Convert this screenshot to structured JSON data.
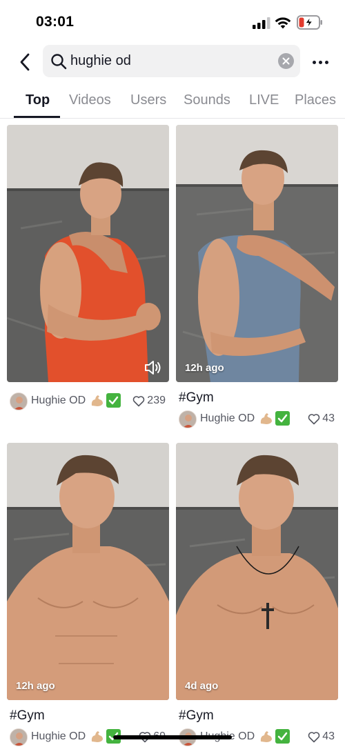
{
  "status_bar": {
    "time": "03:01"
  },
  "search": {
    "query": "hughie od"
  },
  "tabs": [
    {
      "label": "Top",
      "active": true
    },
    {
      "label": "Videos",
      "active": false
    },
    {
      "label": "Users",
      "active": false
    },
    {
      "label": "Sounds",
      "active": false
    },
    {
      "label": "LIVE",
      "active": false
    },
    {
      "label": "Places",
      "active": false
    }
  ],
  "results": [
    {
      "time_ago": "",
      "caption": "",
      "author": "Hughie OD",
      "likes": "239",
      "shirt_color": "#e2502c",
      "has_sound_icon": true
    },
    {
      "time_ago": "12h ago",
      "caption": "#Gym",
      "author": "Hughie OD",
      "likes": "43",
      "shirt_color": "#6f86a0",
      "has_sound_icon": false
    },
    {
      "time_ago": "12h ago",
      "caption": "#Gym",
      "author": "Hughie OD",
      "likes": "69",
      "shirt_color": "",
      "has_sound_icon": false
    },
    {
      "time_ago": "4d ago",
      "caption": "#Gym",
      "author": "Hughie OD",
      "likes": "43",
      "shirt_color": "",
      "has_sound_icon": false
    }
  ],
  "colors": {
    "accent": "#161823",
    "muted": "#8a8b91",
    "check_green": "#44b33f"
  },
  "icons": [
    "back-arrow-icon",
    "search-icon",
    "clear-icon",
    "more-icon",
    "sound-icon",
    "heart-icon",
    "muscle-emoji-icon",
    "check-emoji-icon"
  ]
}
